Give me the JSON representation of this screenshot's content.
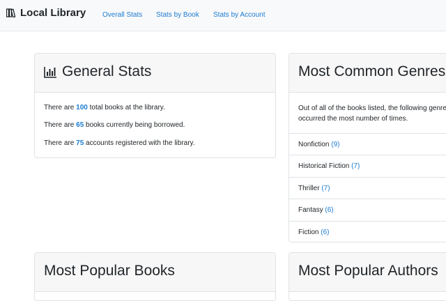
{
  "navbar": {
    "brand": "Local Library",
    "links": [
      "Overall Stats",
      "Stats by Book",
      "Stats by Account"
    ]
  },
  "general_stats": {
    "title": "General Stats",
    "lines": [
      {
        "pre": "There are ",
        "num": "100",
        "post": " total books at the library."
      },
      {
        "pre": "There are ",
        "num": "65",
        "post": " books currently being borrowed."
      },
      {
        "pre": "There are ",
        "num": "75",
        "post": " accounts registered with the library."
      }
    ]
  },
  "genres": {
    "title": "Most Common Genres",
    "desc_line1": "Out of all of the books listed, the following genres",
    "desc_line2": "occurred the most number of times.",
    "items": [
      {
        "name": "Nonfiction",
        "count": "(9)"
      },
      {
        "name": "Historical Fiction",
        "count": "(7)"
      },
      {
        "name": "Thriller",
        "count": "(7)"
      },
      {
        "name": "Fantasy",
        "count": "(6)"
      },
      {
        "name": "Fiction",
        "count": "(6)"
      }
    ]
  },
  "popular_books": {
    "title": "Most Popular Books"
  },
  "popular_authors": {
    "title": "Most Popular Authors"
  },
  "colors": {
    "link": "#1b7bd1",
    "navbar_bg": "#f8f9fa",
    "card_header_bg": "#f7f7f7"
  }
}
